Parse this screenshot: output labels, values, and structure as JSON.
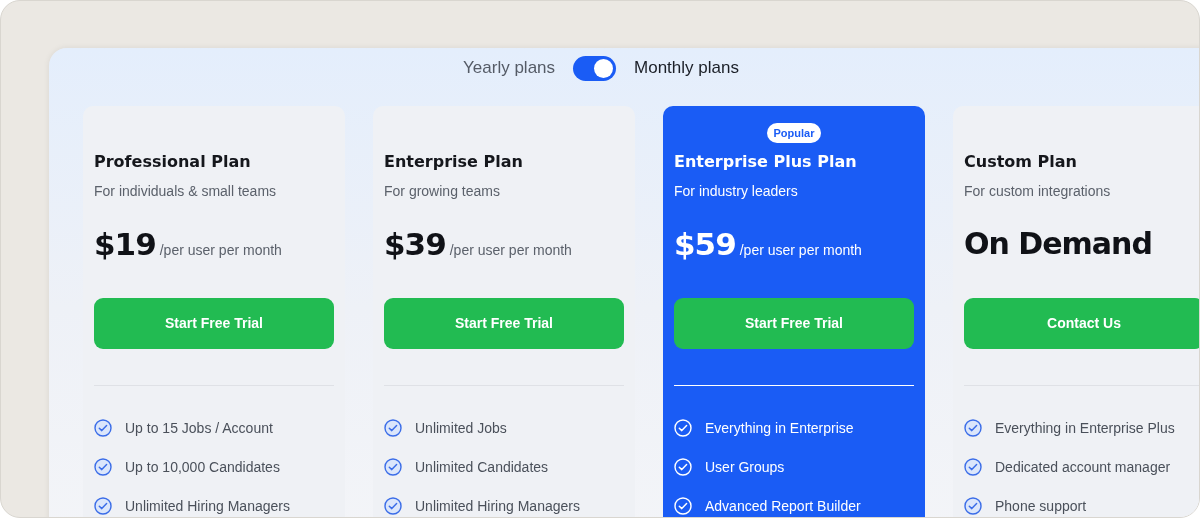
{
  "billing_toggle": {
    "left_label": "Yearly plans",
    "right_label": "Monthly plans",
    "on": true
  },
  "plans": [
    {
      "title": "Professional Plan",
      "subtitle": "For individuals & small teams",
      "price": "$19",
      "price_suffix": "/per user per month",
      "featured": false,
      "button": "Start Free Trial",
      "features": [
        "Up to 15 Jobs / Account",
        "Up to 10,000 Candidates",
        "Unlimited Hiring Managers"
      ]
    },
    {
      "title": "Enterprise Plan",
      "subtitle": "For growing teams",
      "price": "$39",
      "price_suffix": "/per user per month",
      "featured": false,
      "button": "Start Free Trial",
      "features": [
        "Unlimited Jobs",
        "Unlimited Candidates",
        "Unlimited Hiring Managers"
      ]
    },
    {
      "title": "Enterprise Plus Plan",
      "subtitle": "For industry leaders",
      "badge": "Popular",
      "price": "$59",
      "price_suffix": "/per user per month",
      "featured": true,
      "button": "Start Free Trial",
      "features": [
        "Everything in Enterprise",
        "User Groups",
        "Advanced Report Builder"
      ]
    },
    {
      "title": "Custom Plan",
      "subtitle": "For custom integrations",
      "price": "On Demand",
      "featured": false,
      "button": "Contact Us",
      "features": [
        "Everything in Enterprise Plus",
        "Dedicated account manager",
        "Phone support"
      ]
    }
  ]
}
